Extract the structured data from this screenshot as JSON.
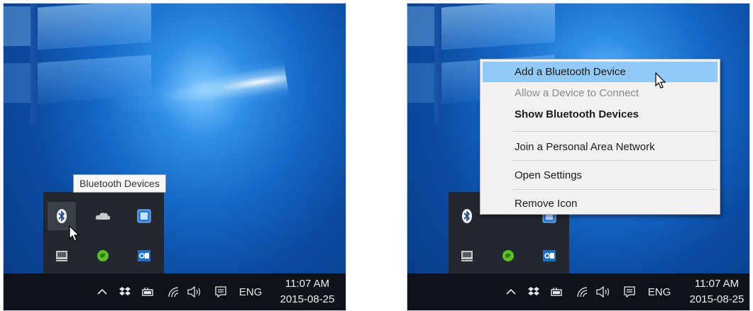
{
  "left_panel": {
    "tooltip": "Bluetooth Devices",
    "taskbar": {
      "language": "ENG",
      "time": "11:07 AM",
      "date": "2015-08-25"
    }
  },
  "right_panel": {
    "context_menu": {
      "items": [
        {
          "label": "Add a Bluetooth Device",
          "state": "highlighted"
        },
        {
          "label": "Allow a Device to Connect",
          "state": "disabled"
        },
        {
          "label": "Show Bluetooth Devices",
          "state": "default-bold"
        },
        {
          "label": "Join a Personal Area Network",
          "state": "normal"
        },
        {
          "label": "Open Settings",
          "state": "normal"
        },
        {
          "label": "Remove Icon",
          "state": "normal"
        }
      ]
    },
    "taskbar": {
      "language": "ENG",
      "time": "11:07 AM",
      "date": "2015-08-25"
    }
  },
  "overflow_icons": [
    "bluetooth-icon",
    "onedrive-icon",
    "app-tile-icon",
    "monitor-icon",
    "evernote-icon",
    "outlook-icon"
  ],
  "tray_icons": [
    "chevron-up-icon",
    "dropbox-icon",
    "power-icon",
    "wifi-icon",
    "speaker-icon",
    "action-center-icon"
  ],
  "colors": {
    "taskbar": "#0f1218",
    "overflow_panel": "#222730",
    "menu_bg": "#f2f2f2",
    "menu_highlight": "#91c9f7",
    "disabled_text": "#8a8a8a"
  }
}
